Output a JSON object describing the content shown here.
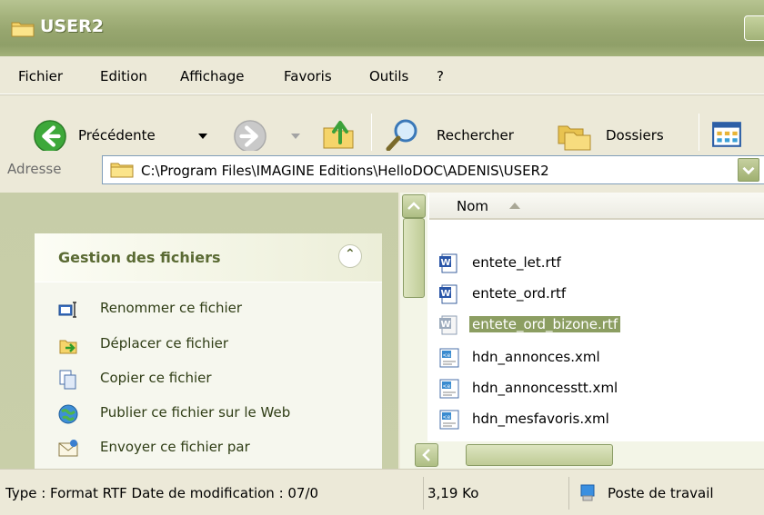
{
  "window": {
    "title": "USER2"
  },
  "menu": [
    "Fichier",
    "Edition",
    "Affichage",
    "Favoris",
    "Outils",
    "?"
  ],
  "toolbar": {
    "back_label": "Précédente",
    "search_label": "Rechercher",
    "folders_label": "Dossiers"
  },
  "address": {
    "label": "Adresse",
    "path": "C:\\Program Files\\IMAGINE Editions\\HelloDOC\\ADENIS\\USER2"
  },
  "tasks": {
    "title": "Gestion des fichiers",
    "items": [
      {
        "label": "Renommer ce fichier",
        "icon": "rename-icon"
      },
      {
        "label": "Déplacer ce fichier",
        "icon": "move-icon"
      },
      {
        "label": "Copier ce fichier",
        "icon": "copy-icon"
      },
      {
        "label": "Publier ce fichier sur le Web",
        "icon": "globe-icon"
      },
      {
        "label": "Envoyer ce fichier par",
        "icon": "mail-icon"
      }
    ]
  },
  "filelist": {
    "column_name": "Nom",
    "files": [
      {
        "name": "entete_let.rtf",
        "icon": "word-doc-icon",
        "selected": false
      },
      {
        "name": "entete_ord.rtf",
        "icon": "word-doc-icon",
        "selected": false
      },
      {
        "name": "entete_ord_bizone.rtf",
        "icon": "word-doc-icon",
        "selected": true
      },
      {
        "name": "hdn_annonces.xml",
        "icon": "xml-file-icon",
        "selected": false
      },
      {
        "name": "hdn_annoncesstt.xml",
        "icon": "xml-file-icon",
        "selected": false
      },
      {
        "name": "hdn_mesfavoris.xml",
        "icon": "xml-file-icon",
        "selected": false
      }
    ]
  },
  "status": {
    "type_info": "Type : Format RTF Date de modification : 07/0",
    "size": "3,19 Ko",
    "location": "Poste de travail"
  },
  "colors": {
    "selection": "#8c9e62",
    "titlebar": "#97a66f",
    "task_text": "#2f3d15"
  }
}
